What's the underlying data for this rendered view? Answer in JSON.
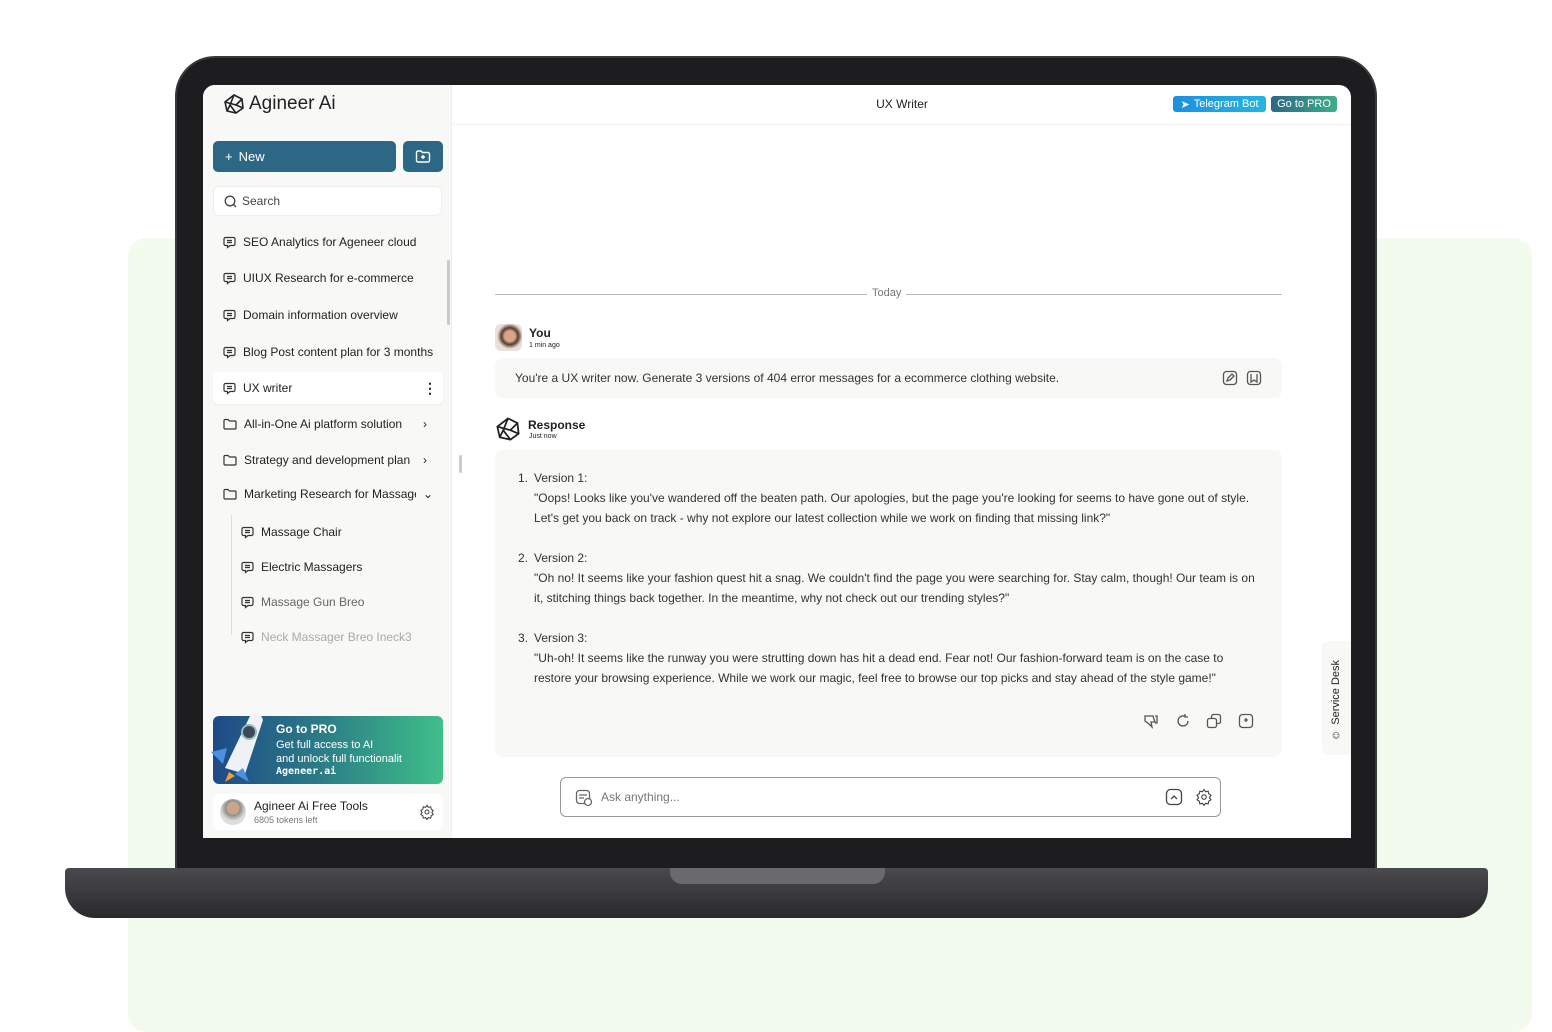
{
  "app": {
    "name": "Agineer Ai"
  },
  "sidebar": {
    "new_label": "New",
    "search_placeholder": "Search",
    "chats": [
      {
        "label": "SEO Analytics for Ageneer cloud"
      },
      {
        "label": "UIUX Research for e-commerce"
      },
      {
        "label": "Domain information overview"
      },
      {
        "label": "Blog Post content plan for 3 months"
      },
      {
        "label": "UX writer",
        "active": true
      }
    ],
    "folders": [
      {
        "label": "All-in-One Ai platform solution",
        "expanded": false
      },
      {
        "label": "Strategy and development plan",
        "expanded": false
      },
      {
        "label": "Marketing Research for Massage",
        "expanded": true
      }
    ],
    "folder_items": [
      {
        "label": "Massage Chair"
      },
      {
        "label": "Electric Massagers"
      },
      {
        "label": "Massage Gun Breo"
      },
      {
        "label": "Neck Massager Breo Ineck3"
      }
    ],
    "promo": {
      "title": "Go to PRO",
      "line1": "Get full access to AI",
      "line2": "and unlock full functionalit",
      "brand": "Ageneer.ai"
    },
    "user": {
      "name": "Agineer Ai Free Tools",
      "tokens": "6805 tokens left"
    }
  },
  "header": {
    "title": "UX Writer",
    "telegram_label": "Telegram Bot",
    "pro_label": "Go to PRO"
  },
  "chat": {
    "divider": "Today",
    "user_msg": {
      "author": "You",
      "time": "1 min ago",
      "text": "You're a UX writer now. Generate 3 versions of 404 error messages for a ecommerce clothing website."
    },
    "response": {
      "author": "Response",
      "time": "Just now",
      "items": [
        {
          "num": "1.",
          "title": "Version 1:",
          "text": "\"Oops! Looks like you've wandered off the beaten path. Our apologies, but the page you're looking for seems to have gone out of style. Let's get you back on track - why not explore our latest collection while we work on finding that missing link?\""
        },
        {
          "num": "2.",
          "title": "Version 2:",
          "text": "\"Oh no! It seems like your fashion quest hit a snag. We couldn't find the page you were searching for. Stay calm, though! Our team is on it, stitching things back together. In the meantime, why not check out our trending styles?\""
        },
        {
          "num": "3.",
          "title": "Version 3:",
          "text": "\"Uh-oh! It seems like the runway you were strutting down has hit a dead end. Fear not! Our fashion-forward team is on the case to restore your browsing experience. While we work our magic, feel free to browse our top picks and stay ahead of the style game!\""
        }
      ]
    }
  },
  "composer": {
    "placeholder": "Ask anything..."
  },
  "service_desk": "Service Desk",
  "colors": {
    "primary": "#2c6785",
    "telegram": "#1e9be0",
    "pro_gradient_end": "#3fbf8a"
  }
}
